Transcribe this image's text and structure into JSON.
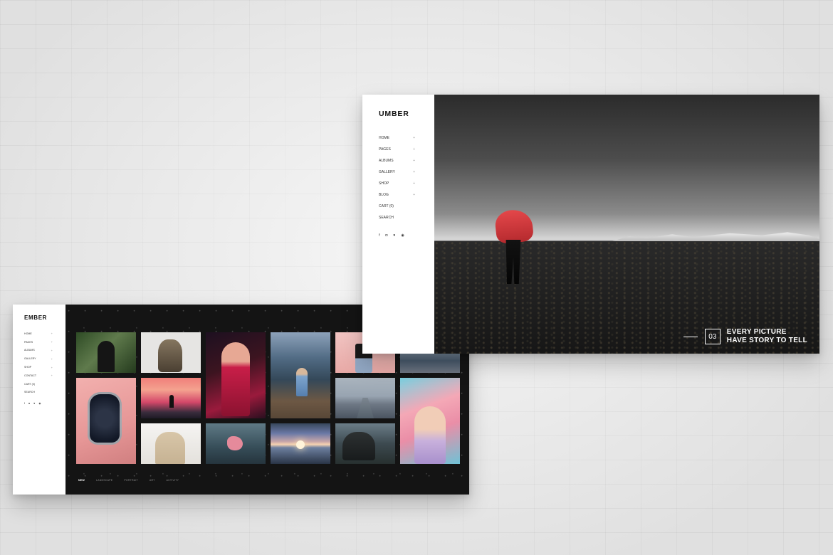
{
  "ember": {
    "logo": "EMBER",
    "menu": [
      {
        "label": "HOME",
        "arrow": "+"
      },
      {
        "label": "PAGES",
        "arrow": "+"
      },
      {
        "label": "ALBUMS",
        "arrow": "+"
      },
      {
        "label": "GALLERY",
        "arrow": "+"
      },
      {
        "label": "SHOP",
        "arrow": "+"
      },
      {
        "label": "CONTACT",
        "arrow": "+"
      },
      {
        "label": "CART (0)",
        "arrow": ""
      },
      {
        "label": "SEARCH",
        "arrow": ""
      }
    ],
    "socials": [
      "f",
      "◘",
      "♥",
      "◉"
    ],
    "filters": [
      "NEW",
      "LANDSCAPE",
      "PORTRAIT",
      "ART",
      "ACTIVITY"
    ]
  },
  "umber": {
    "logo": "UMBER",
    "menu": [
      {
        "label": "HOME",
        "arrow": "+"
      },
      {
        "label": "PAGES",
        "arrow": "+"
      },
      {
        "label": "ALBUMS",
        "arrow": "+"
      },
      {
        "label": "GALLERY",
        "arrow": "+"
      },
      {
        "label": "SHOP",
        "arrow": "+"
      },
      {
        "label": "BLOG",
        "arrow": "+"
      },
      {
        "label": "CART (0)",
        "arrow": ""
      },
      {
        "label": "SEARCH",
        "arrow": ""
      }
    ],
    "socials": [
      "f",
      "◘",
      "♥",
      "◉"
    ],
    "slide_number": "03",
    "caption_line1": "EVERY PICTURE",
    "caption_line2": "HAVE STORY TO TELL"
  },
  "colors": {
    "wall": "#ececec",
    "sidebar": "#ffffff",
    "gallery_bg": "#141414",
    "accent_red": "#d83b3f"
  }
}
